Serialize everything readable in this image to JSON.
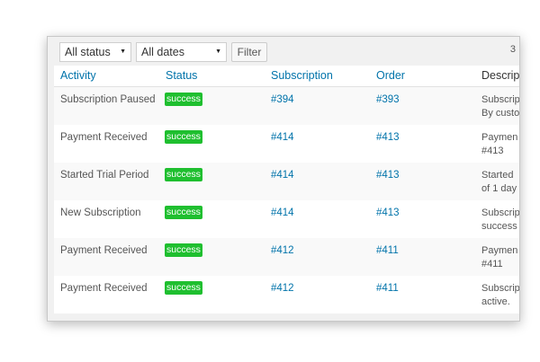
{
  "toolbar": {
    "status_filter": "All status",
    "date_filter": "All dates",
    "filter_label": "Filter",
    "count": "3"
  },
  "columns": {
    "activity": "Activity",
    "status": "Status",
    "subscription": "Subscription",
    "order": "Order",
    "description": "Descrip"
  },
  "rows": [
    {
      "activity": "Subscription Paused",
      "status": "success",
      "subscription": "#394",
      "order": "#393",
      "desc1": "Subscrip",
      "desc2": "By custo"
    },
    {
      "activity": "Payment Received",
      "status": "success",
      "subscription": "#414",
      "order": "#413",
      "desc1": "Paymen",
      "desc2": "#413"
    },
    {
      "activity": "Started Trial Period",
      "status": "success",
      "subscription": "#414",
      "order": "#413",
      "desc1": "Started",
      "desc2": "of 1 day"
    },
    {
      "activity": "New Subscription",
      "status": "success",
      "subscription": "#414",
      "order": "#413",
      "desc1": "Subscrip",
      "desc2": "success"
    },
    {
      "activity": "Payment Received",
      "status": "success",
      "subscription": "#412",
      "order": "#411",
      "desc1": "Paymen",
      "desc2": "#411"
    },
    {
      "activity": "Payment Received",
      "status": "success",
      "subscription": "#412",
      "order": "#411",
      "desc1": "Subscrip",
      "desc2": "active."
    }
  ],
  "colors": {
    "link": "#0073aa",
    "success_badge": "#1fbf2f"
  }
}
